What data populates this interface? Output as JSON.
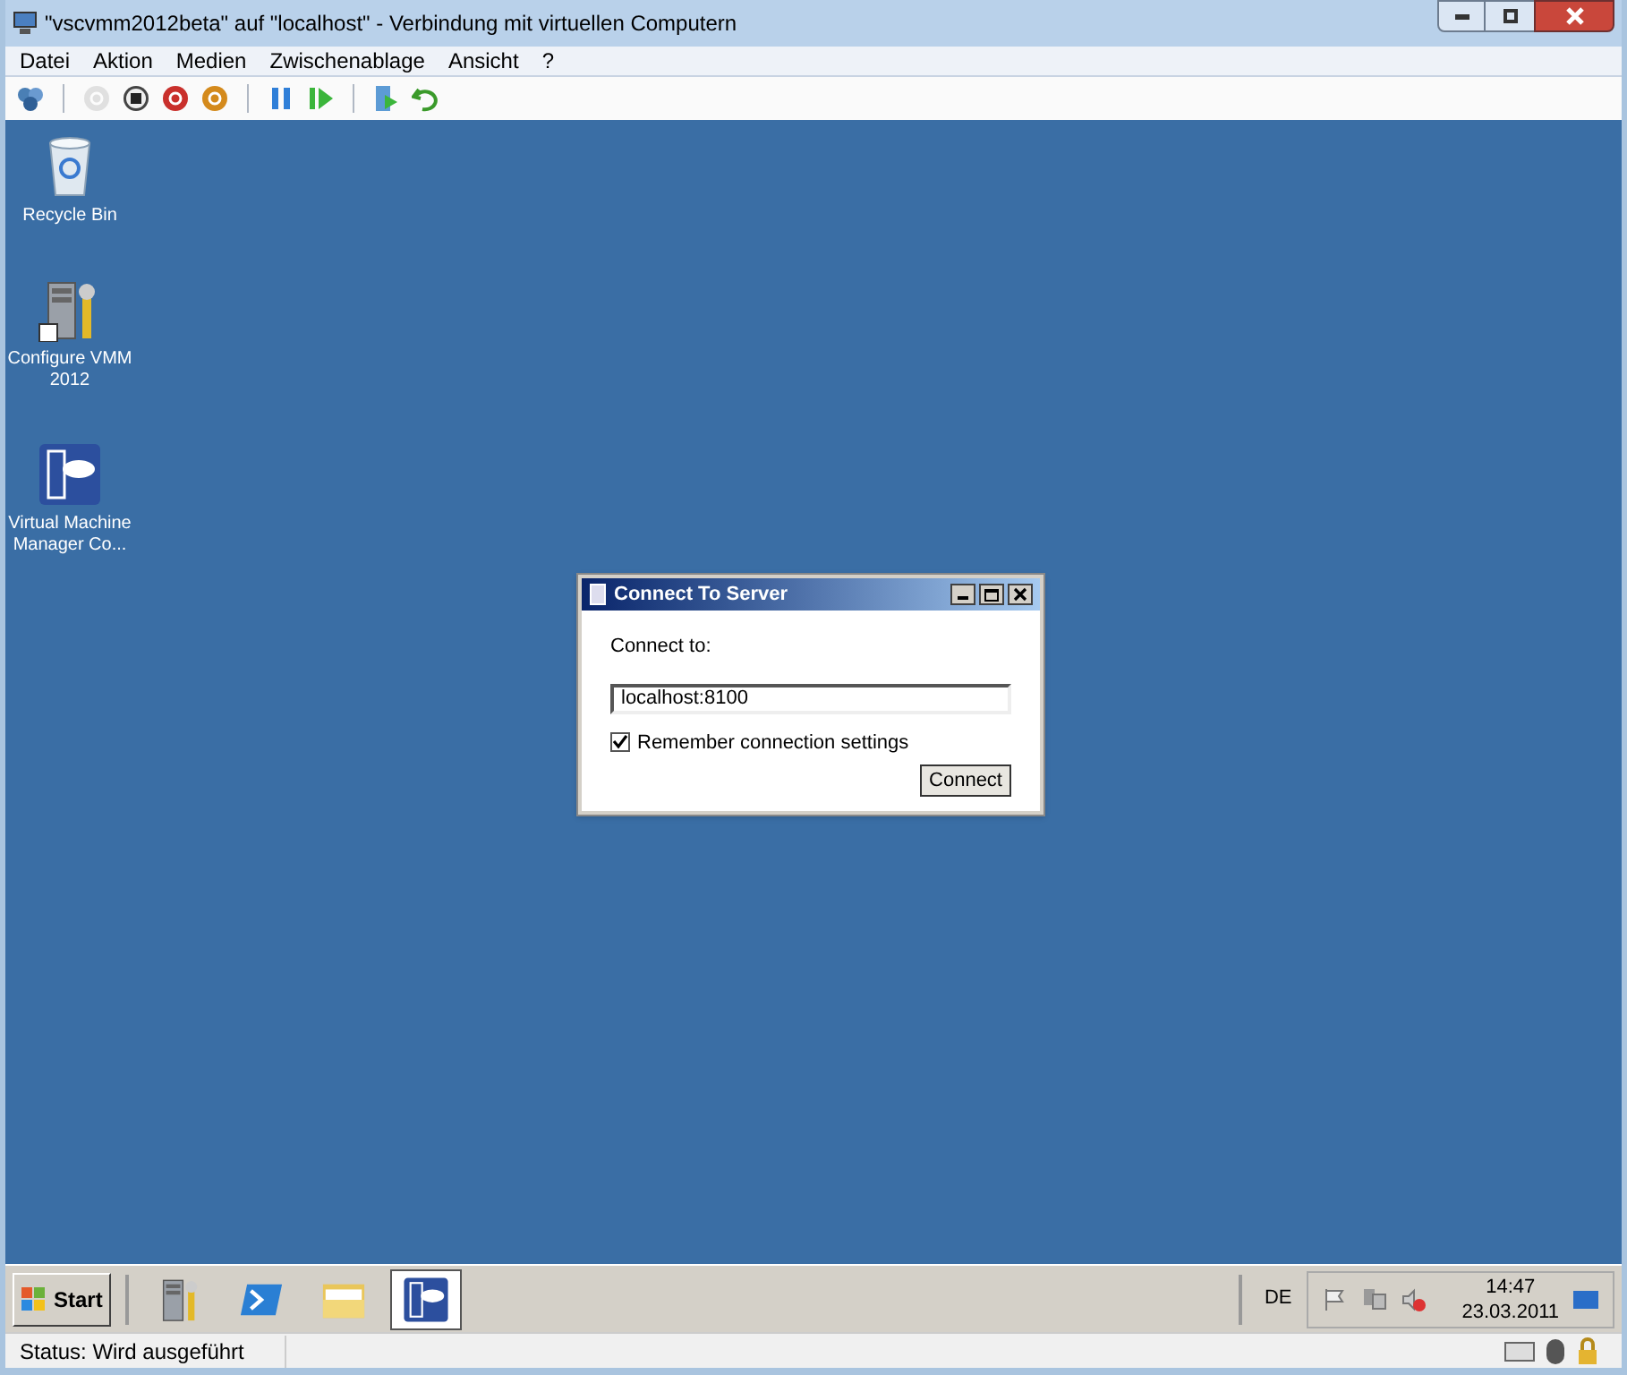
{
  "window": {
    "title": "\"vscvmm2012beta\" auf \"localhost\" - Verbindung mit virtuellen Computern"
  },
  "menu": [
    "Datei",
    "Aktion",
    "Medien",
    "Zwischenablage",
    "Ansicht",
    "?"
  ],
  "toolbar": [
    {
      "kind": "ctrlaltdel",
      "disabled": false
    },
    {
      "kind": "sep"
    },
    {
      "kind": "power",
      "disabled": true
    },
    {
      "kind": "stop",
      "disabled": false
    },
    {
      "kind": "shutdown",
      "disabled": false
    },
    {
      "kind": "save",
      "disabled": false
    },
    {
      "kind": "sep"
    },
    {
      "kind": "pause",
      "disabled": false
    },
    {
      "kind": "resume",
      "disabled": false
    },
    {
      "kind": "sep"
    },
    {
      "kind": "snapshot",
      "disabled": false
    },
    {
      "kind": "revert",
      "disabled": false
    }
  ],
  "desktop_icons": [
    {
      "kind": "recycle",
      "label": "Recycle Bin"
    },
    {
      "kind": "server",
      "label": "Configure VMM 2012"
    },
    {
      "kind": "vmm",
      "label": "Virtual Machine Manager Co..."
    }
  ],
  "dialog": {
    "title": "Connect To Server",
    "field_label": "Connect to:",
    "field_value": "localhost:8100",
    "checkbox": {
      "label": "Remember connection settings",
      "checked": true
    },
    "button": "Connect"
  },
  "taskbar": {
    "start": "Start",
    "apps": [
      {
        "kind": "server",
        "selected": false
      },
      {
        "kind": "powershell",
        "selected": false
      },
      {
        "kind": "explorer",
        "selected": false
      },
      {
        "kind": "vmm",
        "selected": true
      }
    ],
    "language": "DE",
    "time": "14:47",
    "date": "23.03.2011"
  },
  "status_bar": {
    "text": "Status: Wird ausgeführt"
  }
}
